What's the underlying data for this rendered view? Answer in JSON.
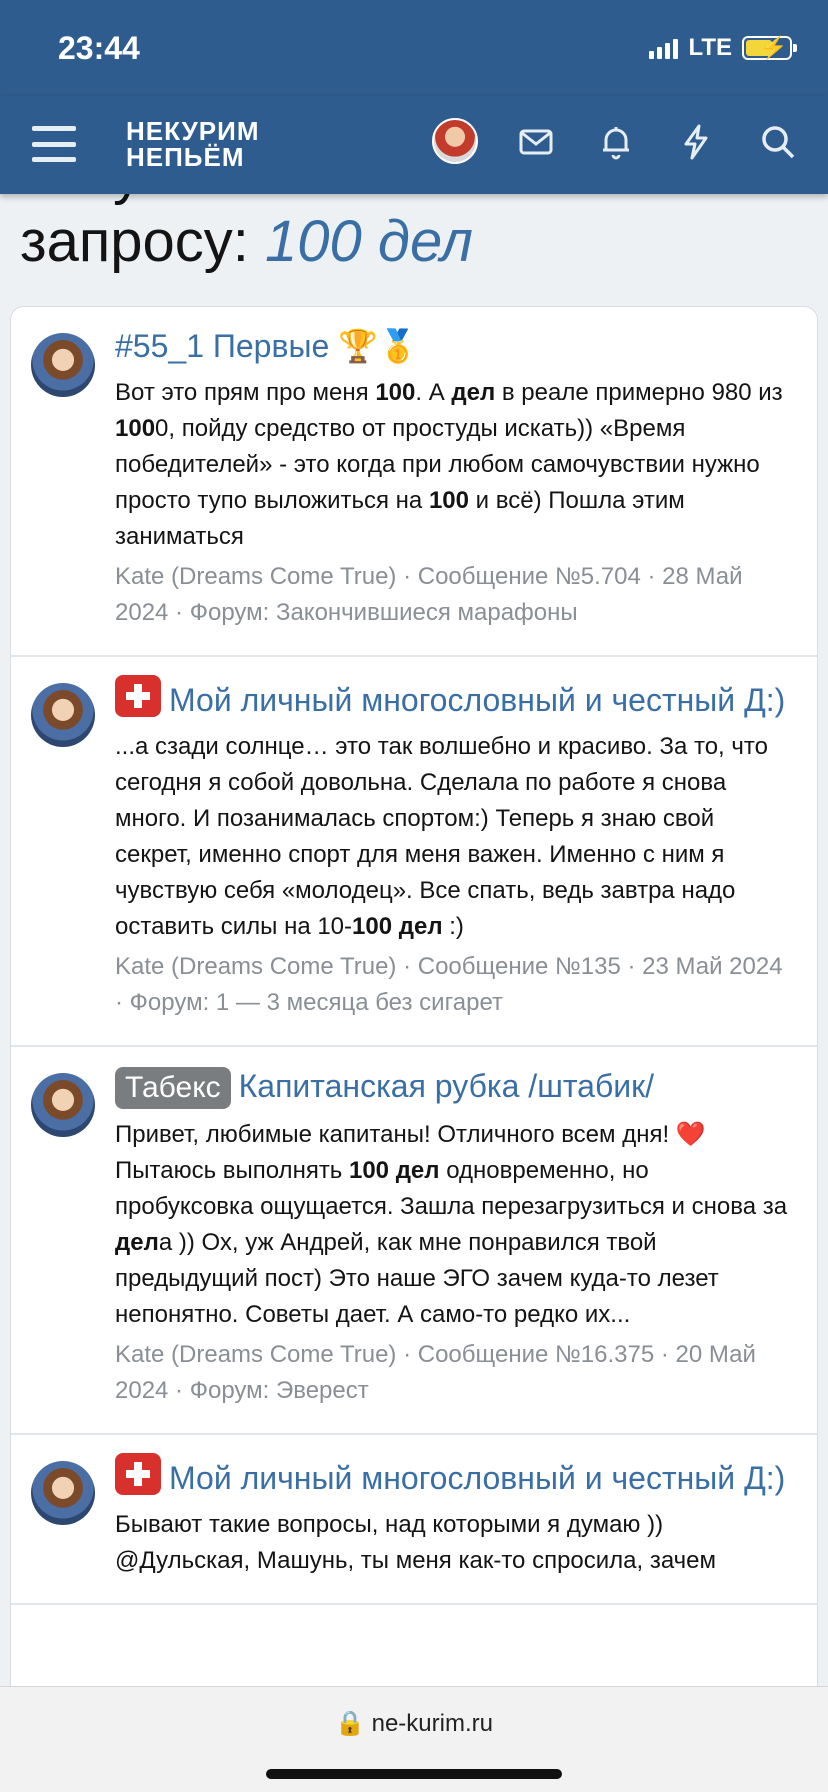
{
  "status": {
    "time": "23:44",
    "network": "LTE"
  },
  "nav": {
    "logo_line1": "НЕКУРИМ",
    "logo_line2": "НЕПЬЁМ"
  },
  "heading": {
    "prefix_hidden": "Результаты поиска по",
    "prefix": "запросу:",
    "query": "100 дел"
  },
  "results": [
    {
      "title": "#55_1 Первые",
      "title_emoji": "🏆🥇",
      "snippet": [
        {
          "t": "Вот это прям про меня "
        },
        {
          "b": "100"
        },
        {
          "t": ". А "
        },
        {
          "b": "дел"
        },
        {
          "t": " в реале примерно 980 из "
        },
        {
          "b": "100"
        },
        {
          "t": "0, пойду средство от простуды искать)) «Время победителей» - это когда при любом самочувствии нужно просто тупо выложиться на "
        },
        {
          "b": "100"
        },
        {
          "t": " и всё) Пошла этим заниматься"
        }
      ],
      "meta": "Kate (Dreams Come True) · Сообщение №5.704 · 28 Май 2024 · Форум: Закончившиеся марафоны"
    },
    {
      "badge": "red",
      "title": "Мой личный многословный и честный Д:)",
      "snippet": [
        {
          "t": "...а сзади солнце… это так волшебно и красиво. За то, что сегодня я собой довольна. Сделала по работе я снова много. И позанималась спортом:) Теперь я знаю свой секрет, именно спорт для меня важен. Именно с ним я чувствую себя «молодец». Все спать, ведь завтра надо оставить силы на 10-"
        },
        {
          "b": "100 дел"
        },
        {
          "t": " :)"
        }
      ],
      "meta": "Kate (Dreams Come True) · Сообщение №135 · 23 Май 2024 · Форум: 1 — 3 месяца без сигарет"
    },
    {
      "badge": "gray",
      "badge_text": "Табекс",
      "title": "Капитанская рубка /штабик/",
      "snippet": [
        {
          "t": "Привет, любимые капитаны! Отличного всем дня! ❤️ Пытаюсь выполнять "
        },
        {
          "b": "100 дел"
        },
        {
          "t": " одновременно, но пробуксовка ощущается. Зашла перезагрузиться и снова за "
        },
        {
          "b": "дел"
        },
        {
          "t": "а )) Ох, уж Андрей, как мне понравился твой предыдущий пост) Это наше ЭГО зачем куда-то лезет непонятно. Советы дает. А само-то редко их..."
        }
      ],
      "meta": "Kate (Dreams Come True) · Сообщение №16.375 · 20 Май 2024 · Форум: Эверест"
    },
    {
      "badge": "red",
      "title": "Мой личный многословный и честный Д:)",
      "snippet": [
        {
          "t": "Бывают такие вопросы, над которыми я думаю )) @Дульская, Машунь, ты меня как-то спросила, зачем"
        }
      ],
      "meta": ""
    }
  ],
  "browser": {
    "url": "ne-kurim.ru"
  }
}
